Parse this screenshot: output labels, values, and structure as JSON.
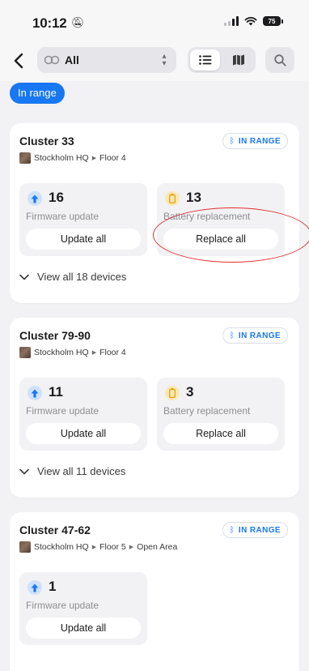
{
  "status_bar": {
    "time": "10:12",
    "battery": "75"
  },
  "nav": {
    "filter_value": "All",
    "views": [
      "list",
      "map"
    ],
    "active_view": "list"
  },
  "chip": {
    "label": "In range"
  },
  "clusters": [
    {
      "title": "Cluster 33",
      "badge": "IN RANGE",
      "location": [
        "Stockholm HQ",
        "Floor 4"
      ],
      "tiles": [
        {
          "icon": "arrow-up-icon",
          "count": "16",
          "label": "Firmware update",
          "button": "Update all"
        },
        {
          "icon": "battery-icon",
          "count": "13",
          "label": "Battery replacement",
          "button": "Replace all"
        }
      ],
      "view_all": "View all 18 devices"
    },
    {
      "title": "Cluster 79-90",
      "badge": "IN RANGE",
      "location": [
        "Stockholm HQ",
        "Floor 4"
      ],
      "tiles": [
        {
          "icon": "arrow-up-icon",
          "count": "11",
          "label": "Firmware update",
          "button": "Update all"
        },
        {
          "icon": "battery-icon",
          "count": "3",
          "label": "Battery replacement",
          "button": "Replace all"
        }
      ],
      "view_all": "View all 11 devices"
    },
    {
      "title": "Cluster 47-62",
      "badge": "IN RANGE",
      "location": [
        "Stockholm HQ",
        "Floor 5",
        "Open Area"
      ],
      "tiles": [
        {
          "icon": "arrow-up-icon",
          "count": "1",
          "label": "Firmware update",
          "button": "Update all"
        }
      ]
    }
  ],
  "colors": {
    "accent": "#1877f2",
    "firmware_icon_bg": "#cfe2fb",
    "battery_icon_bg": "#fbe7b8",
    "annotation": "#e0302e"
  }
}
